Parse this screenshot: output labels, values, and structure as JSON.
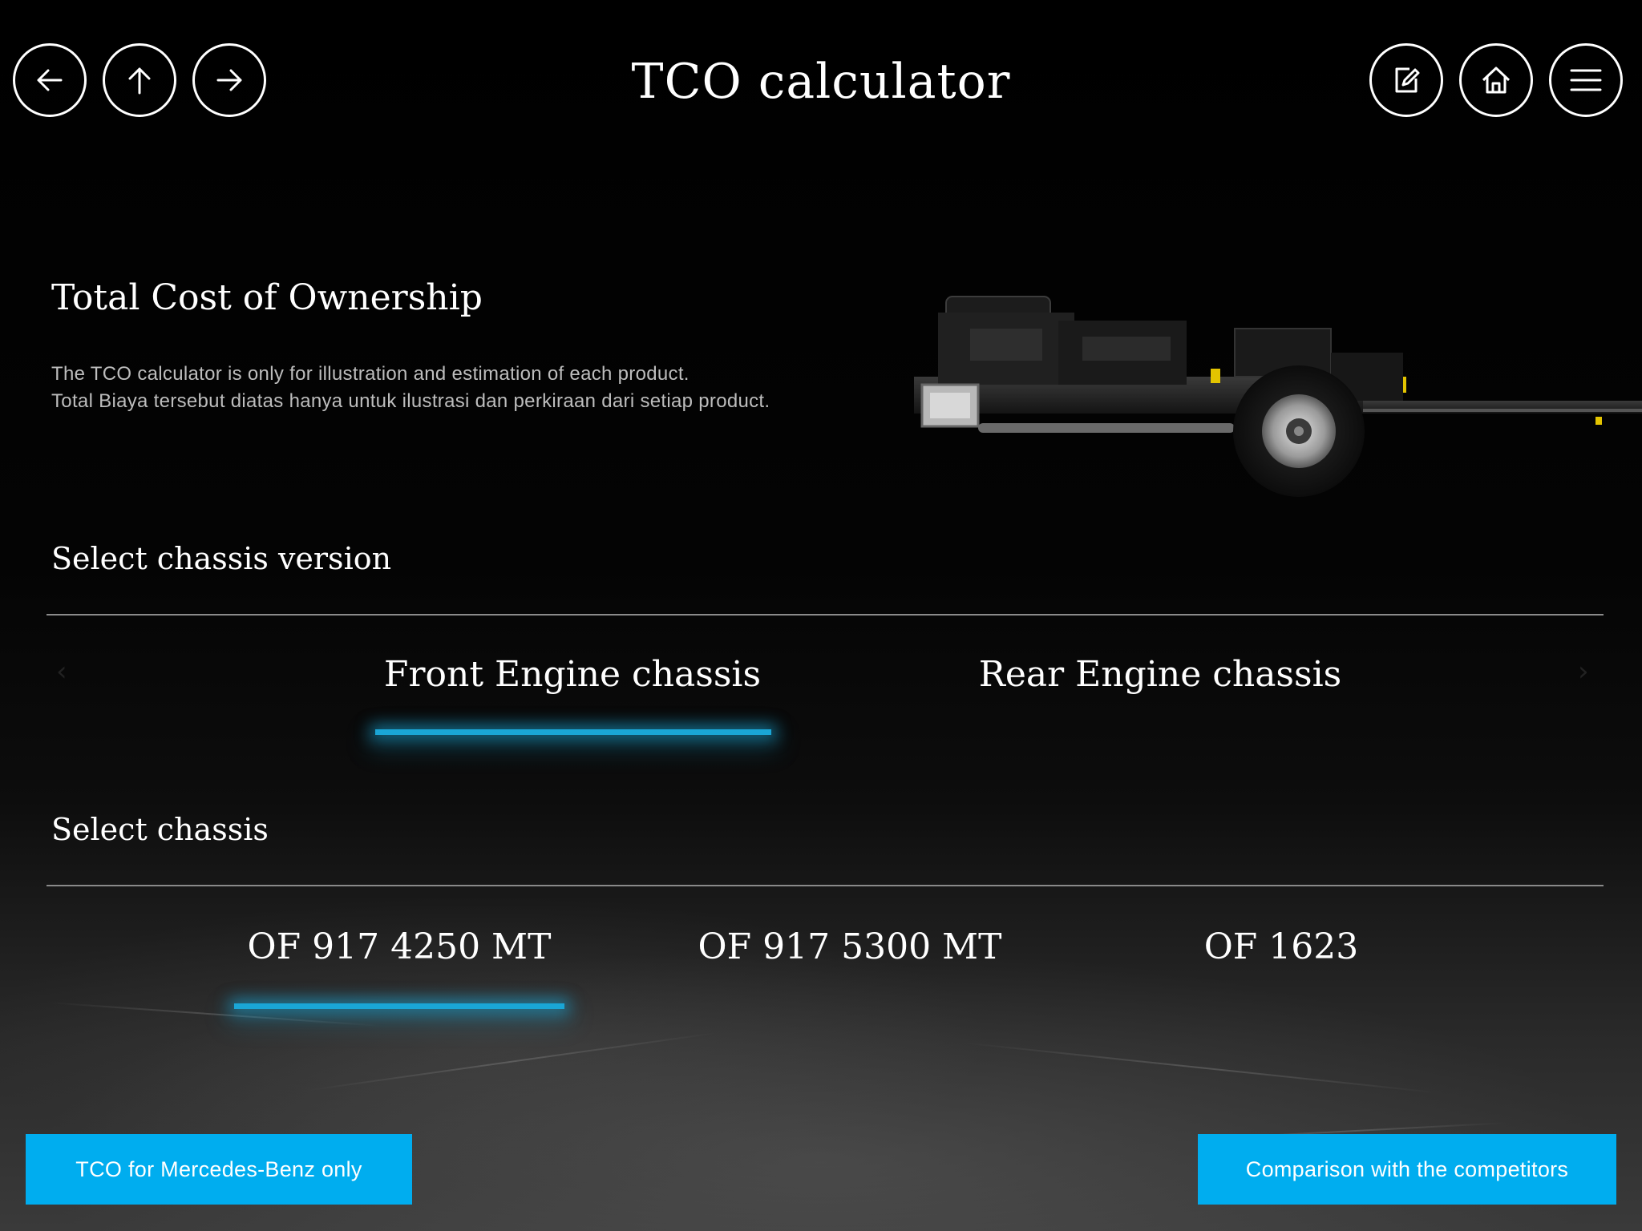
{
  "header": {
    "title": "TCO calculator",
    "nav_icons": [
      "arrow-left-icon",
      "arrow-up-icon",
      "arrow-right-icon"
    ],
    "action_icons": [
      "edit-icon",
      "home-icon",
      "menu-icon"
    ]
  },
  "intro": {
    "heading": "Total Cost of Ownership",
    "line1": "The TCO calculator is only for illustration and estimation of each product.",
    "line2": "Total Biaya tersebut diatas hanya untuk ilustrasi dan perkiraan dari setiap product."
  },
  "chassis_version": {
    "label": "Select chassis version",
    "options": [
      "Front Engine chassis",
      "Rear Engine chassis"
    ],
    "selected": "Front Engine chassis"
  },
  "chassis": {
    "label": "Select chassis",
    "options": [
      "OF 917 4250 MT",
      "OF 917 5300 MT",
      "OF 1623"
    ],
    "selected": "OF 917 4250 MT"
  },
  "actions": {
    "mercedes_only": "TCO for Mercedes-Benz only",
    "comparison": "Comparison with the competitors"
  },
  "colors": {
    "accent": "#00adef",
    "underline": "#1aa6d6",
    "background": "#000000"
  }
}
